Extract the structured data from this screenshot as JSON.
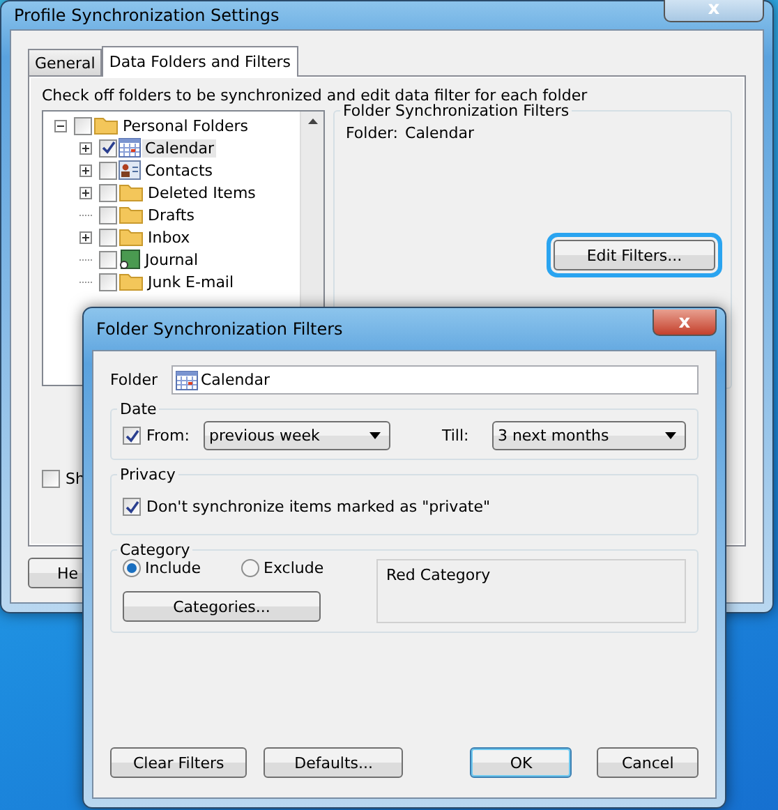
{
  "window": {
    "title": "Profile Synchronization Settings",
    "close": "x"
  },
  "tabs": [
    {
      "label": "General",
      "selected": false
    },
    {
      "label": "Data Folders and Filters",
      "selected": true
    }
  ],
  "instructions": "Check off folders to be synchronized and edit data filter for each folder",
  "folder_tree": [
    {
      "label": "Personal Folders",
      "kind": "folder",
      "expanded": true,
      "checked": false,
      "selected": false,
      "children": [
        {
          "label": "Calendar",
          "kind": "calendar",
          "expanded": false,
          "checked": true,
          "selected": true
        },
        {
          "label": "Contacts",
          "kind": "contacts",
          "expanded": false,
          "checked": false,
          "selected": false
        },
        {
          "label": "Deleted Items",
          "kind": "folder",
          "expanded": false,
          "checked": false,
          "selected": false
        },
        {
          "label": "Drafts",
          "kind": "folder",
          "checked": false,
          "selected": false
        },
        {
          "label": "Inbox",
          "kind": "folder",
          "expanded": false,
          "checked": false,
          "selected": false
        },
        {
          "label": "Journal",
          "kind": "journal",
          "checked": false,
          "selected": false
        },
        {
          "label": "Junk E-mail",
          "kind": "folder",
          "checked": false,
          "selected": false
        }
      ]
    }
  ],
  "filters_group": {
    "title": "Folder Synchronization Filters",
    "folder_label": "Folder:",
    "folder_value": "Calendar",
    "edit_button": "Edit Filters..."
  },
  "show_checkbox": {
    "label": "Sh",
    "checked": false
  },
  "bottom_buttons": [
    {
      "label": "He"
    }
  ],
  "dialog": {
    "title": "Folder Synchronization Filters",
    "close": "x",
    "folder_label": "Folder",
    "folder_value": "Calendar",
    "date": {
      "title": "Date",
      "from_checked": true,
      "from_label": "From:",
      "from_value": "previous week",
      "till_label": "Till:",
      "till_value": "3 next months"
    },
    "privacy": {
      "title": "Privacy",
      "checked": true,
      "label": "Don't synchronize items marked as \"private\""
    },
    "category": {
      "title": "Category",
      "options": [
        {
          "label": "Include",
          "selected": true
        },
        {
          "label": "Exclude",
          "selected": false
        }
      ],
      "button": "Categories...",
      "list": [
        "Red Category"
      ]
    },
    "buttons": [
      {
        "label": "Clear Filters",
        "default": false
      },
      {
        "label": "Defaults...",
        "default": false
      },
      {
        "label": "OK",
        "default": true
      },
      {
        "label": "Cancel",
        "default": false
      }
    ]
  }
}
